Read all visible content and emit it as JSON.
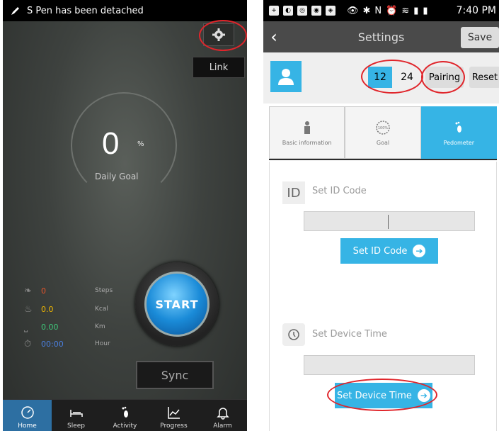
{
  "left": {
    "status": "S Pen has been detached",
    "link_label": "Link",
    "progress_value": "0",
    "progress_unit": "%",
    "daily_goal_label": "Daily Goal",
    "stats": [
      {
        "value": "0",
        "label": "Steps",
        "color": "#e8542a"
      },
      {
        "value": "0.0",
        "label": "Kcal",
        "color": "#f2b800"
      },
      {
        "value": "0.00",
        "label": "Km",
        "color": "#3fc87a"
      },
      {
        "value": "00:00",
        "label": "Hour",
        "color": "#4a7fe0"
      }
    ],
    "start_label": "START",
    "sync_label": "Sync",
    "tabs": [
      {
        "label": "Home",
        "icon": "gauge-icon",
        "active": true
      },
      {
        "label": "Sleep",
        "icon": "bed-icon",
        "active": false
      },
      {
        "label": "Activity",
        "icon": "footprint-icon",
        "active": false
      },
      {
        "label": "Progress",
        "icon": "chart-icon",
        "active": false
      },
      {
        "label": "Alarm",
        "icon": "bell-icon",
        "active": false
      }
    ]
  },
  "right": {
    "time": "7:40 PM",
    "title": "Settings",
    "save_label": "Save",
    "hour_12": "12",
    "hour_24": "24",
    "pairing_label": "Pairing",
    "reset_label": "Reset",
    "tabs": [
      {
        "label": "Basic information",
        "icon": "person-icon",
        "active": false
      },
      {
        "label": "Goal",
        "icon": "goal-icon",
        "active": false,
        "badge": "100%"
      },
      {
        "label": "Pedometer",
        "icon": "footprint-icon",
        "active": true
      }
    ],
    "id_icon_text": "ID",
    "set_id_label": "Set ID Code",
    "set_id_button": "Set ID Code",
    "set_time_label": "Set Device Time",
    "set_time_button": "Set Device Time"
  },
  "colors": {
    "accent": "#36b4e5",
    "annotation": "#e0252b",
    "active_tab": "#2d6fa2"
  }
}
